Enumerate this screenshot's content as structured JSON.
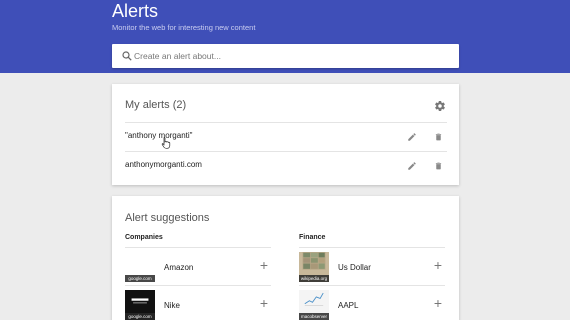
{
  "header": {
    "title": "Alerts",
    "subtitle": "Monitor the web for interesting new content"
  },
  "search": {
    "placeholder": "Create an alert about..."
  },
  "my_alerts": {
    "title": "My alerts",
    "count": "(2)",
    "items": [
      {
        "label": "\"anthony morganti\""
      },
      {
        "label": "anthonymorganti.com"
      }
    ]
  },
  "suggestions": {
    "title": "Alert suggestions",
    "companies": {
      "header": "Companies",
      "items": [
        {
          "name": "Amazon",
          "source": "google.com",
          "add_label": "+"
        },
        {
          "name": "Nike",
          "source": "google.com",
          "add_label": "+"
        }
      ]
    },
    "finance": {
      "header": "Finance",
      "items": [
        {
          "name": "Us Dollar",
          "source": "wikipedia.org",
          "add_label": "+"
        },
        {
          "name": "AAPL",
          "source": "macobserver",
          "add_label": "+"
        }
      ]
    }
  },
  "colors": {
    "header_bg": "#3f4fb8",
    "page_bg": "#ececec",
    "icon_gray": "#777777"
  }
}
